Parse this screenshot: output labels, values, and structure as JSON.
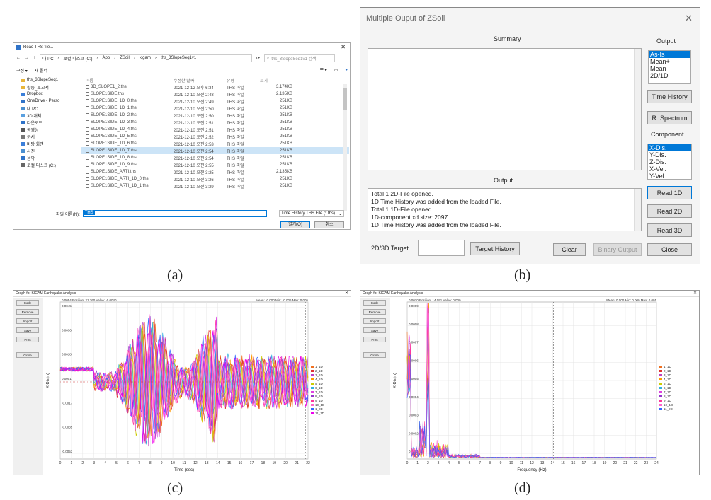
{
  "captions": {
    "a": "(a)",
    "b": "(b)",
    "c": "(c)",
    "d": "(d)"
  },
  "file_dialog": {
    "title": "Read THS file...",
    "path": [
      "내 PC",
      "로컬 디스크 (C:)",
      "App",
      "ZSoil",
      "kigam",
      "ths_3SlopeSeq1v1"
    ],
    "search_placeholder": "ths_3SlopeSeq1v1 검색",
    "organize": "구성 ▾",
    "new_folder": "새 폴더",
    "nav": [
      {
        "label": "ths_3SlopeSeq1",
        "color": "#e8b53a"
      },
      {
        "label": "활동_보고서",
        "color": "#e8b53a"
      },
      {
        "label": "Dropbox",
        "color": "#3b7fd9"
      },
      {
        "label": "OneDrive - Perso",
        "color": "#2f73c8"
      },
      {
        "label": "내 PC",
        "color": "#4a8fd0"
      },
      {
        "label": "3D 개체",
        "color": "#5aa0e0"
      },
      {
        "label": "다운로드",
        "color": "#2f73c8"
      },
      {
        "label": "동영상",
        "color": "#555"
      },
      {
        "label": "문서",
        "color": "#777"
      },
      {
        "label": "바탕 화면",
        "color": "#3b7fd9"
      },
      {
        "label": "사진",
        "color": "#4a8fd0"
      },
      {
        "label": "음악",
        "color": "#2f73c8"
      },
      {
        "label": "로컬 디스크 (C:)",
        "color": "#666"
      }
    ],
    "columns": [
      "이름",
      "수정한 날짜",
      "유형",
      "크기"
    ],
    "files": [
      {
        "name": "3D_SLOPE1_2.ths",
        "date": "2021-12-12 오후 6:34",
        "type": "THS 파일",
        "size": "3,174KB"
      },
      {
        "name": "SLOPE1SIDE.ths",
        "date": "2021-12-10 오전 2:48",
        "type": "THS 파일",
        "size": "2,135KB"
      },
      {
        "name": "SLOPE1SIDE_1D_0.ths",
        "date": "2021-12-10 오전 2:49",
        "type": "THS 파일",
        "size": "251KB"
      },
      {
        "name": "SLOPE1SIDE_1D_1.ths",
        "date": "2021-12-10 오전 2:50",
        "type": "THS 파일",
        "size": "251KB"
      },
      {
        "name": "SLOPE1SIDE_1D_2.ths",
        "date": "2021-12-10 오전 2:50",
        "type": "THS 파일",
        "size": "251KB"
      },
      {
        "name": "SLOPE1SIDE_1D_3.ths",
        "date": "2021-12-10 오전 2:51",
        "type": "THS 파일",
        "size": "251KB"
      },
      {
        "name": "SLOPE1SIDE_1D_4.ths",
        "date": "2021-12-10 오전 2:51",
        "type": "THS 파일",
        "size": "251KB"
      },
      {
        "name": "SLOPE1SIDE_1D_5.ths",
        "date": "2021-12-10 오전 2:52",
        "type": "THS 파일",
        "size": "251KB"
      },
      {
        "name": "SLOPE1SIDE_1D_6.ths",
        "date": "2021-12-10 오전 2:53",
        "type": "THS 파일",
        "size": "251KB"
      },
      {
        "name": "SLOPE1SIDE_1D_7.ths",
        "date": "2021-12-10 오전 2:54",
        "type": "THS 파일",
        "size": "251KB"
      },
      {
        "name": "SLOPE1SIDE_1D_8.ths",
        "date": "2021-12-10 오전 2:54",
        "type": "THS 파일",
        "size": "251KB"
      },
      {
        "name": "SLOPE1SIDE_1D_9.ths",
        "date": "2021-12-10 오전 2:55",
        "type": "THS 파일",
        "size": "251KB"
      },
      {
        "name": "SLOPE1SIDE_ARTI.ths",
        "date": "2021-12-10 오전 3:25",
        "type": "THS 파일",
        "size": "2,135KB"
      },
      {
        "name": "SLOPE1SIDE_ARTI_1D_0.ths",
        "date": "2021-12-10 오전 3:26",
        "type": "THS 파일",
        "size": "251KB"
      },
      {
        "name": "SLOPE1SIDE_ARTI_1D_1.ths",
        "date": "2021-12-10 오전 3:29",
        "type": "THS 파일",
        "size": "251KB"
      }
    ],
    "filename_label": "파일 이름(N):",
    "filename_value": "THS",
    "filetype": "Time History THS File (*.ths)",
    "open": "열기(O)",
    "cancel": "취소"
  },
  "zsoil": {
    "title": "Multiple Ouput of ZSoil",
    "summary_label": "Summary",
    "output_label": "Output",
    "output_list": [
      "As-Is",
      "Mean+",
      "Mean",
      "2D/1D"
    ],
    "time_history": "Time History",
    "r_spectrum": "R. Spectrum",
    "component_label": "Component",
    "component_list": [
      "X-Dis.",
      "Y-Dis.",
      "Z-Dis.",
      "X-Vel.",
      "Y-Vel."
    ],
    "read_1d": "Read 1D",
    "read_2d": "Read 2D",
    "read_3d": "Read 3D",
    "output_panel_label": "Output",
    "log": [
      "Total 1 2D-File opened.",
      "1D Time History was added from the loaded File.",
      "Total 1 1D-File opened.",
      " 1D-component xd size: 2097",
      "1D Time History was added from the loaded File."
    ],
    "target_label": "2D/3D Target",
    "target_history": "Target History",
    "clear": "Clear",
    "binary_output": "Binary Output",
    "close": "Close"
  },
  "graph_c": {
    "title": "Graph for KIGAM Earthquake Analysis",
    "buttons": [
      "Code",
      "Remove",
      "Import",
      "Save",
      "Print",
      "Close"
    ],
    "status": "0.0054 Position: 21.760   Value: -0.0040",
    "stats": "Mean: -0.000   Min: -0.006   Max: 0.005",
    "xlabel": "Time (sec)",
    "ylabel": "X-Dis(m)",
    "yticks": [
      "0.0045",
      "0.0036",
      "0.0018",
      "0.0001",
      "-0.0017",
      "-0.0035",
      "-0.0053"
    ],
    "xticks": [
      "0",
      "1",
      "2",
      "3",
      "4",
      "5",
      "6",
      "7",
      "8",
      "9",
      "10",
      "11",
      "12",
      "13",
      "14",
      "15",
      "16",
      "17",
      "18",
      "19",
      "20",
      "21",
      "22"
    ],
    "legend": [
      "1_1D",
      "2_1D",
      "3_1D",
      "4_1D",
      "5_1D",
      "6_1D",
      "7_1D",
      "8_1D",
      "9_1D",
      "10_1D",
      "1_2D",
      "11_1D"
    ]
  },
  "graph_d": {
    "title": "Graph for KIGAM Earthquake Analysis",
    "buttons": [
      "Code",
      "Remove",
      "Import",
      "Save",
      "Print",
      "Close"
    ],
    "status": "0.0010 Position: 14.091   Value: 0.000",
    "stats": "Mean: 0.000   Min: 0.000   Max: 0.001",
    "xlabel": "Frequency (Hz)",
    "ylabel": "X-Dis(m)",
    "yticks": [
      "0.0009",
      "0.0008",
      "0.0007",
      "0.0006",
      "0.0005",
      "0.0004",
      "0.0003",
      "0.0002",
      "0.0001"
    ],
    "xticks": [
      "0",
      "1",
      "2",
      "3",
      "4",
      "5",
      "6",
      "7",
      "8",
      "9",
      "10",
      "11",
      "12",
      "13",
      "14",
      "15",
      "16",
      "17",
      "18",
      "19",
      "20",
      "21",
      "22",
      "23",
      "24"
    ],
    "legend": [
      "1_1D",
      "2_1D",
      "3_1D",
      "4_1D",
      "5_1D",
      "6_1D",
      "7_1D",
      "8_1D",
      "9_1D",
      "10_1D",
      "11_2D"
    ]
  },
  "colors": {
    "series": [
      "#f07020",
      "#e03030",
      "#c040c0",
      "#ff9900",
      "#cccc00",
      "#30b0e0",
      "#e040e0",
      "#9933cc",
      "#ff3399",
      "#ff66cc",
      "#3366ff",
      "#ee00ee"
    ]
  }
}
